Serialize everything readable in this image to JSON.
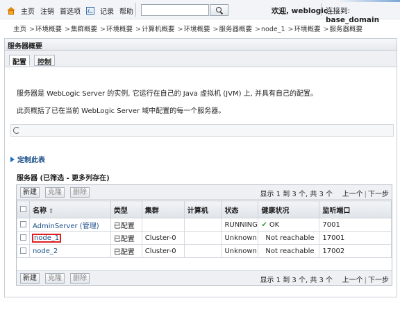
{
  "topbar": {
    "home": "主页",
    "logout": "注销",
    "preferences": "首选项",
    "record": "记录",
    "help": "帮助",
    "search_value": "",
    "welcome": "欢迎, weblogic",
    "connected_label": "连接到:",
    "connected_domain": "base_domain"
  },
  "breadcrumb": [
    "主页",
    "环境概要",
    "集群概要",
    "环境概要",
    "计算机概要",
    "环境概要",
    "服务器概要",
    "node_1",
    "环境概要",
    "服务器概要"
  ],
  "panel": {
    "title": "服务器概要",
    "tabs": [
      {
        "label": "配置"
      },
      {
        "label": "控制"
      }
    ]
  },
  "content": {
    "desc1": "服务器是 WebLogic Server 的实例, 它运行在自己的 Java 虚拟机 (JVM) 上, 并具有自己的配置。",
    "desc2": "此页概括了已在当前 WebLogic Server 域中配置的每一个服务器。",
    "customize": "定制此表",
    "table_title": "服务器 (已筛选 - 更多列存在)"
  },
  "toolbar": {
    "new": "新建",
    "clone": "克隆",
    "delete": "删除",
    "pager_info": "显示 1 到 3 个, 共 3 个",
    "prev": "上一个",
    "next": "下一步"
  },
  "table": {
    "headers": [
      "名称",
      "类型",
      "集群",
      "计算机",
      "状态",
      "健康状况",
      "监听端口"
    ],
    "rows": [
      {
        "name": "AdminServer (管理)",
        "type": "已配置",
        "cluster": "",
        "machine": "",
        "state": "RUNNING",
        "health": "OK",
        "port": "7001"
      },
      {
        "name": "node_1",
        "type": "已配置",
        "cluster": "Cluster-0",
        "machine": "",
        "state": "Unknown",
        "health": "Not reachable",
        "port": "17001"
      },
      {
        "name": "node_2",
        "type": "已配置",
        "cluster": "Cluster-0",
        "machine": "",
        "state": "Unknown",
        "health": "Not reachable",
        "port": "17002"
      }
    ]
  }
}
